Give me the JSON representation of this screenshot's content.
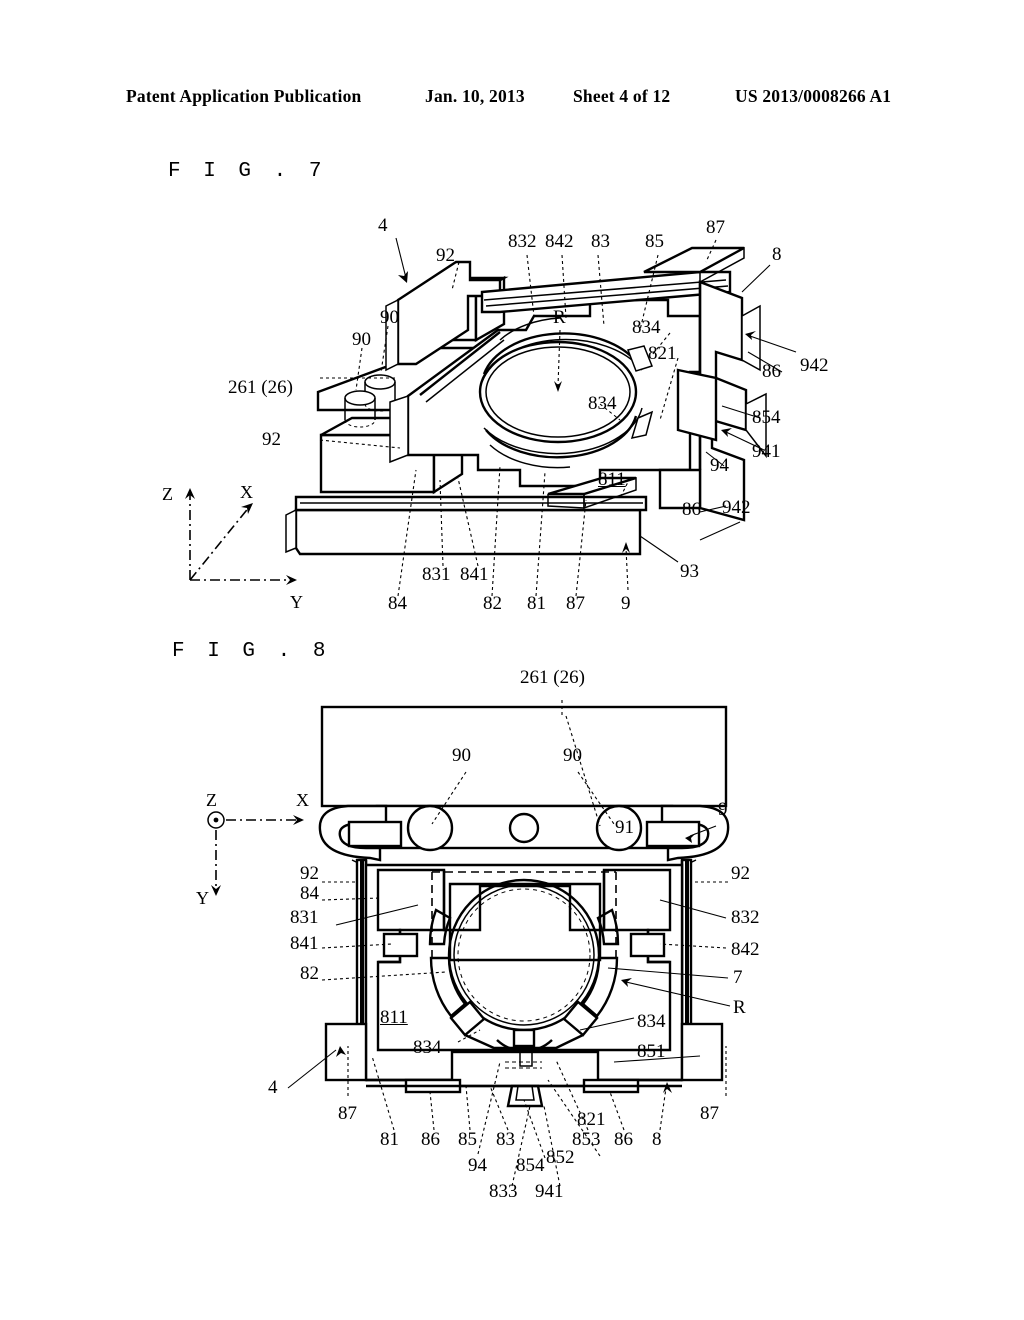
{
  "header": {
    "title": "Patent Application Publication",
    "date": "Jan. 10, 2013",
    "sheet": "Sheet 4 of 12",
    "patent_number": "US 2013/0008266 A1"
  },
  "figures": [
    {
      "caption": "F I G .  7",
      "type": "isometric-perspective-view",
      "axes": {
        "z": "Z",
        "x": "X",
        "y": "Y"
      },
      "labels": [
        {
          "id": "f7-4",
          "text": "4"
        },
        {
          "id": "f7-92a",
          "text": "92"
        },
        {
          "id": "f7-832",
          "text": "832"
        },
        {
          "id": "f7-842",
          "text": "842"
        },
        {
          "id": "f7-83",
          "text": "83"
        },
        {
          "id": "f7-85",
          "text": "85"
        },
        {
          "id": "f7-87a",
          "text": "87"
        },
        {
          "id": "f7-8",
          "text": "8"
        },
        {
          "id": "f7-90a",
          "text": "90"
        },
        {
          "id": "f7-90b",
          "text": "90"
        },
        {
          "id": "f7-R",
          "text": "R"
        },
        {
          "id": "f7-834a",
          "text": "834"
        },
        {
          "id": "f7-821",
          "text": "821"
        },
        {
          "id": "f7-86a",
          "text": "86"
        },
        {
          "id": "f7-942a",
          "text": "942"
        },
        {
          "id": "f7-261",
          "text": "261 (26)"
        },
        {
          "id": "f7-834b",
          "text": "834"
        },
        {
          "id": "f7-854",
          "text": "854"
        },
        {
          "id": "f7-941",
          "text": "941"
        },
        {
          "id": "f7-94",
          "text": "94"
        },
        {
          "id": "f7-92b",
          "text": "92"
        },
        {
          "id": "f7-811",
          "text": "811"
        },
        {
          "id": "f7-86b",
          "text": "86"
        },
        {
          "id": "f7-942b",
          "text": "942"
        },
        {
          "id": "f7-93",
          "text": "93"
        },
        {
          "id": "f7-831",
          "text": "831"
        },
        {
          "id": "f7-841",
          "text": "841"
        },
        {
          "id": "f7-84",
          "text": "84"
        },
        {
          "id": "f7-82",
          "text": "82"
        },
        {
          "id": "f7-81",
          "text": "81"
        },
        {
          "id": "f7-87b",
          "text": "87"
        },
        {
          "id": "f7-9",
          "text": "9"
        }
      ]
    },
    {
      "caption": "F I G .  8",
      "type": "plan-view",
      "axes": {
        "z": "Z",
        "x": "X",
        "y": "Y"
      },
      "labels": [
        {
          "id": "f8-261",
          "text": "261 (26)"
        },
        {
          "id": "f8-90a",
          "text": "90"
        },
        {
          "id": "f8-90b",
          "text": "90"
        },
        {
          "id": "f8-91",
          "text": "91"
        },
        {
          "id": "f8-9",
          "text": "9"
        },
        {
          "id": "f8-92a",
          "text": "92"
        },
        {
          "id": "f8-92b",
          "text": "92"
        },
        {
          "id": "f8-84",
          "text": "84"
        },
        {
          "id": "f8-831",
          "text": "831"
        },
        {
          "id": "f8-832",
          "text": "832"
        },
        {
          "id": "f8-841",
          "text": "841"
        },
        {
          "id": "f8-842",
          "text": "842"
        },
        {
          "id": "f8-82",
          "text": "82"
        },
        {
          "id": "f8-7",
          "text": "7"
        },
        {
          "id": "f8-R",
          "text": "R"
        },
        {
          "id": "f8-811",
          "text": "811"
        },
        {
          "id": "f8-834a",
          "text": "834"
        },
        {
          "id": "f8-834b",
          "text": "834"
        },
        {
          "id": "f8-851",
          "text": "851"
        },
        {
          "id": "f8-4",
          "text": "4"
        },
        {
          "id": "f8-87a",
          "text": "87"
        },
        {
          "id": "f8-87b",
          "text": "87"
        },
        {
          "id": "f8-81",
          "text": "81"
        },
        {
          "id": "f8-86a",
          "text": "86"
        },
        {
          "id": "f8-86b",
          "text": "86"
        },
        {
          "id": "f8-85",
          "text": "85"
        },
        {
          "id": "f8-83",
          "text": "83"
        },
        {
          "id": "f8-821",
          "text": "821"
        },
        {
          "id": "f8-853",
          "text": "853"
        },
        {
          "id": "f8-8",
          "text": "8"
        },
        {
          "id": "f8-94",
          "text": "94"
        },
        {
          "id": "f8-854",
          "text": "854"
        },
        {
          "id": "f8-852",
          "text": "852"
        },
        {
          "id": "f8-833",
          "text": "833"
        },
        {
          "id": "f8-941",
          "text": "941"
        }
      ]
    }
  ]
}
